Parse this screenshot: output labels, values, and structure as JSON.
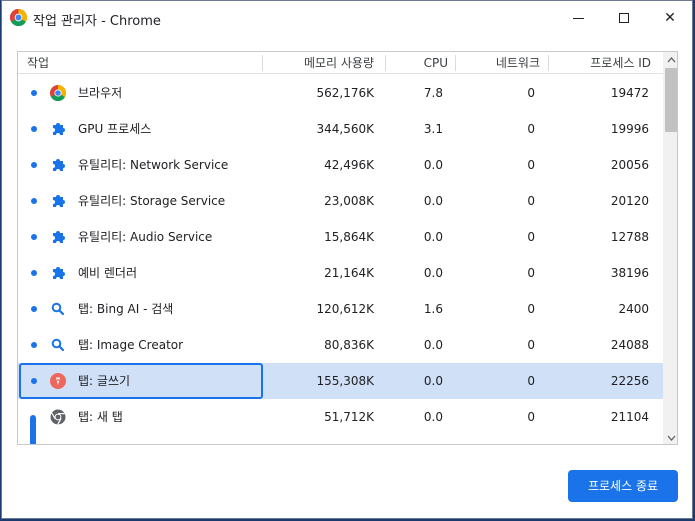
{
  "window": {
    "title": "작업 관리자 - Chrome",
    "minimize_label": "",
    "maximize_label": "",
    "close_label": "✕"
  },
  "table": {
    "columns": {
      "task": "작업",
      "memory": "메모리 사용량",
      "cpu": "CPU",
      "network": "네트워크",
      "pid": "프로세스 ID"
    },
    "rows": [
      {
        "name": "브라우저",
        "memory": "562,176K",
        "cpu": "7.8",
        "network": "0",
        "pid": "19472",
        "icon": "chrome-icon"
      },
      {
        "name": "GPU 프로세스",
        "memory": "344,560K",
        "cpu": "3.1",
        "network": "0",
        "pid": "19996",
        "icon": "puzzle-icon"
      },
      {
        "name": "유틸리티: Network Service",
        "memory": "42,496K",
        "cpu": "0.0",
        "network": "0",
        "pid": "20056",
        "icon": "puzzle-icon"
      },
      {
        "name": "유틸리티: Storage Service",
        "memory": "23,008K",
        "cpu": "0.0",
        "network": "0",
        "pid": "20120",
        "icon": "puzzle-icon"
      },
      {
        "name": "유틸리티: Audio Service",
        "memory": "15,864K",
        "cpu": "0.0",
        "network": "0",
        "pid": "12788",
        "icon": "puzzle-icon"
      },
      {
        "name": "예비 렌더러",
        "memory": "21,164K",
        "cpu": "0.0",
        "network": "0",
        "pid": "38196",
        "icon": "puzzle-icon"
      },
      {
        "name": "탭: Bing AI - 검색",
        "memory": "120,612K",
        "cpu": "1.6",
        "network": "0",
        "pid": "2400",
        "icon": "search-icon"
      },
      {
        "name": "탭: Image Creator",
        "memory": "80,836K",
        "cpu": "0.0",
        "network": "0",
        "pid": "24088",
        "icon": "search-icon"
      },
      {
        "name": "탭: 글쓰기",
        "memory": "155,308K",
        "cpu": "0.0",
        "network": "0",
        "pid": "22256",
        "icon": "pen-app-icon"
      },
      {
        "name": "탭: 새 탭",
        "memory": "51,712K",
        "cpu": "0.0",
        "network": "0",
        "pid": "21104",
        "icon": "chrome-mono-icon"
      }
    ]
  },
  "actions": {
    "end_process": "프로세스 종료"
  },
  "colors": {
    "accent": "#1a73e8",
    "selected_row": "#cfe0f7"
  }
}
